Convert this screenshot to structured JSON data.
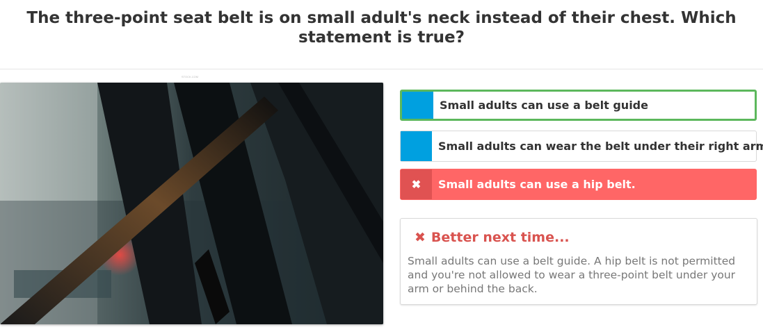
{
  "question": "The three-point seat belt is on small adult's neck instead of their chest. Which statement is true?",
  "image": {
    "caption": "STOCK.COM"
  },
  "answers": [
    {
      "label": "Small adults can use a belt guide",
      "state": "correct-selected",
      "marker": ""
    },
    {
      "label": "Small adults can wear the belt under their right arm",
      "state": "neutral",
      "marker": ""
    },
    {
      "label": "Small adults can use a hip belt.",
      "state": "wrong-selected",
      "marker": "✖"
    }
  ],
  "feedback": {
    "icon": "✖",
    "title": "Better next time...",
    "body": "Small adults can use a belt guide. A hip belt is not permitted and you're not allowed to wear a three-point belt under your arm or behind the back."
  },
  "colors": {
    "marker_blue": "#00a0e0",
    "correct_border": "#5cb85c",
    "wrong_bg": "#ff6666",
    "feedback_red": "#d9534f"
  }
}
